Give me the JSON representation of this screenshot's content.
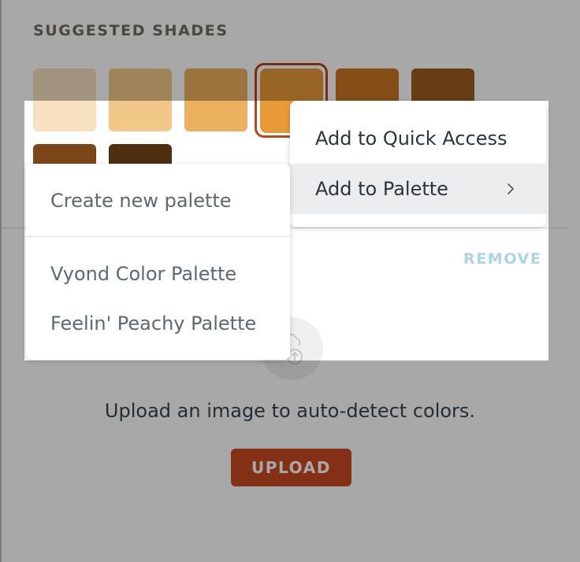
{
  "panel": {
    "section_title": "SUGGESTED SHADES",
    "remove_label": "REMOVE",
    "upload_hint": "Upload an image to auto-detect colors.",
    "upload_label": "UPLOAD"
  },
  "swatches": [
    {
      "color": "#f8e1c1"
    },
    {
      "color": "#f1c888"
    },
    {
      "color": "#ecb15f"
    },
    {
      "color": "#e99a38",
      "selected": true
    },
    {
      "color": "#c97722"
    },
    {
      "color": "#9c5d20"
    },
    {
      "color": "#7c4717"
    },
    {
      "color": "#4d2e10"
    }
  ],
  "context_menu": {
    "items": [
      {
        "label": "Add to Quick Access"
      },
      {
        "label": "Add to Palette",
        "has_submenu": true
      }
    ]
  },
  "submenu": {
    "create_label": "Create new palette",
    "palettes": [
      {
        "label": "Vyond Color Palette"
      },
      {
        "label": "Feelin' Peachy Palette"
      }
    ]
  },
  "colors": {
    "accent": "#c84a22",
    "remove_link": "#a9d6e1",
    "text_dark": "#2b353d",
    "text_muted": "#5e6870"
  }
}
